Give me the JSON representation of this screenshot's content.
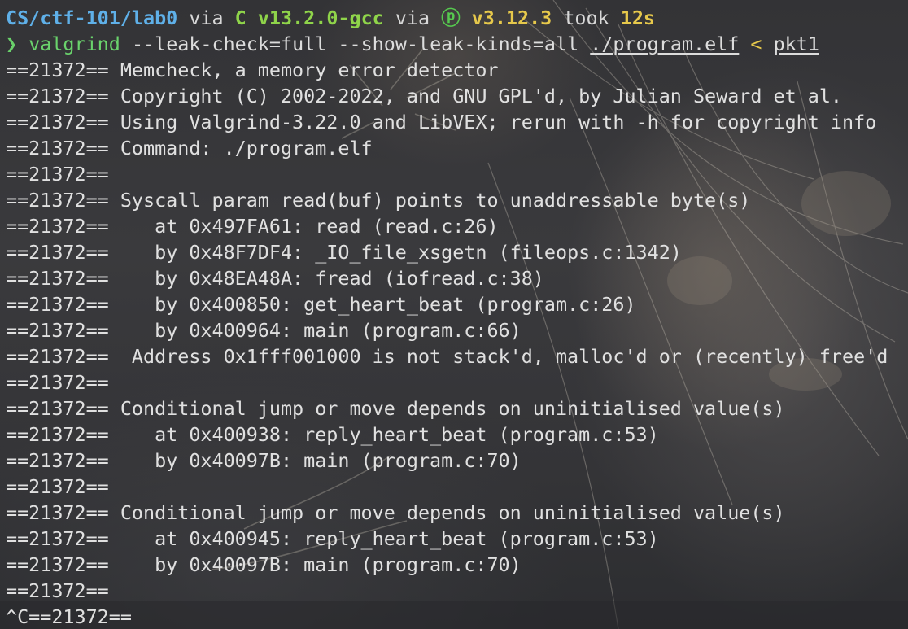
{
  "prompt_line": {
    "path": "CS/ctf-101/lab0",
    "via1": " via ",
    "lang_icon": "C",
    "lang_version": " v13.2.0-gcc",
    "via2": " via ",
    "python_icon": "python-icon",
    "python_version": " v3.12.3",
    "took": " took ",
    "duration": "12s"
  },
  "command_line": {
    "prompt_char": "❯",
    "command": "valgrind",
    "args": " --leak-check=full --show-leak-kinds=all ",
    "program": "./program.elf",
    "redirect": " < ",
    "input_file": "pkt1"
  },
  "output": [
    "==21372== Memcheck, a memory error detector",
    "==21372== Copyright (C) 2002-2022, and GNU GPL'd, by Julian Seward et al.",
    "==21372== Using Valgrind-3.22.0 and LibVEX; rerun with -h for copyright info",
    "==21372== Command: ./program.elf",
    "==21372==",
    "==21372== Syscall param read(buf) points to unaddressable byte(s)",
    "==21372==    at 0x497FA61: read (read.c:26)",
    "==21372==    by 0x48F7DF4: _IO_file_xsgetn (fileops.c:1342)",
    "==21372==    by 0x48EA48A: fread (iofread.c:38)",
    "==21372==    by 0x400850: get_heart_beat (program.c:26)",
    "==21372==    by 0x400964: main (program.c:66)",
    "==21372==  Address 0x1fff001000 is not stack'd, malloc'd or (recently) free'd",
    "==21372==",
    "==21372== Conditional jump or move depends on uninitialised value(s)",
    "==21372==    at 0x400938: reply_heart_beat (program.c:53)",
    "==21372==    by 0x40097B: main (program.c:70)",
    "==21372==",
    "==21372== Conditional jump or move depends on uninitialised value(s)",
    "==21372==    at 0x400945: reply_heart_beat (program.c:53)",
    "==21372==    by 0x40097B: main (program.c:70)",
    "==21372==",
    "^C==21372=="
  ]
}
